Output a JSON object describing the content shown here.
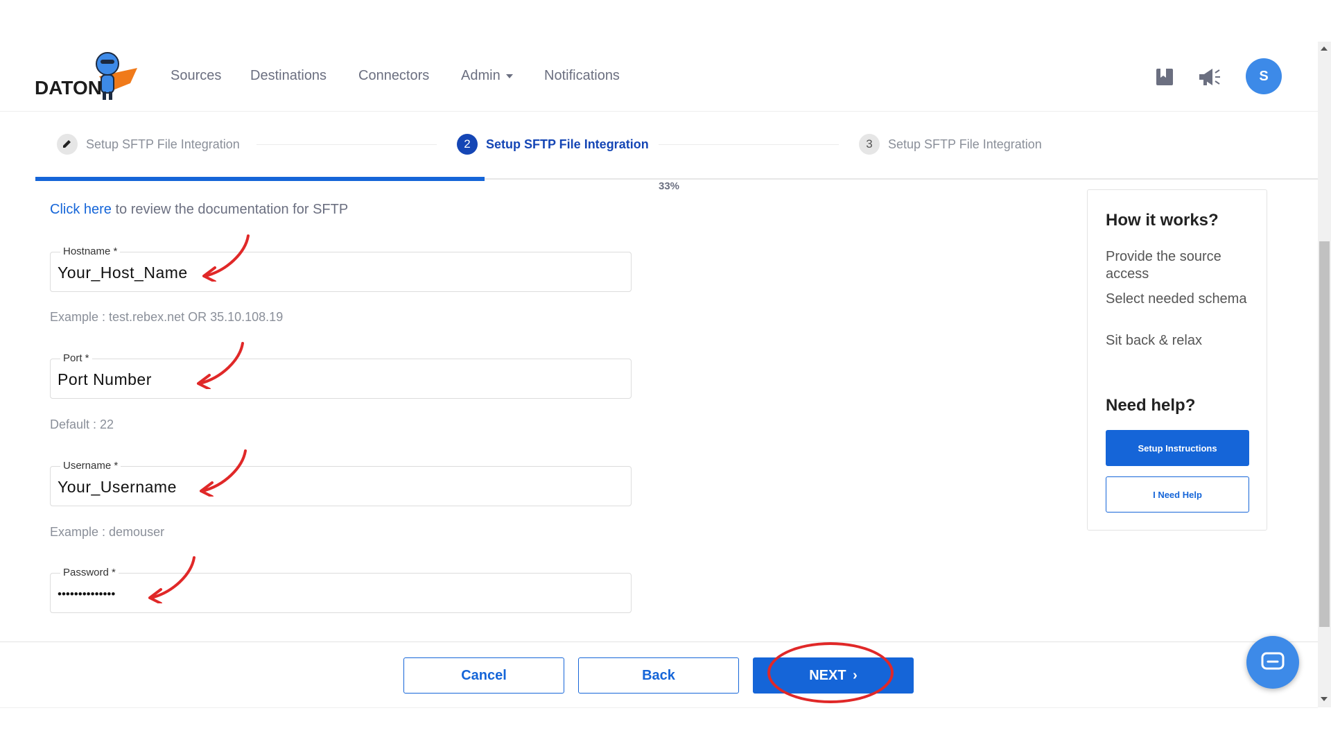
{
  "brand": {
    "logo_text": "DATON"
  },
  "nav": {
    "items": [
      {
        "label": "Sources"
      },
      {
        "label": "Destinations"
      },
      {
        "label": "Connectors"
      },
      {
        "label": "Admin"
      },
      {
        "label": "Notifications"
      }
    ],
    "avatar_initial": "S"
  },
  "stepper": {
    "steps": [
      {
        "number": "",
        "label": "Setup SFTP File Integration",
        "state": "completed"
      },
      {
        "number": "2",
        "label": "Setup SFTP File Integration",
        "state": "active"
      },
      {
        "number": "3",
        "label": "Setup SFTP File Integration",
        "state": "pending"
      }
    ],
    "progress_fraction": 0.33,
    "progress_label": "33%"
  },
  "form": {
    "doc_link_label": "Click here",
    "doc_text": " to review the documentation for SFTP",
    "fields": [
      {
        "label": "Hostname *",
        "value": "Your_Host_Name",
        "helper": "Example : test.rebex.net OR 35.10.108.19"
      },
      {
        "label": "Port *",
        "value": "Port Number",
        "helper": "Default : 22"
      },
      {
        "label": "Username *",
        "value": "Your_Username",
        "helper": "Example : demouser"
      },
      {
        "label": "Password *",
        "value": "••••••••••••••",
        "helper": ""
      }
    ]
  },
  "side_panel": {
    "title": "How it works?",
    "items": [
      "Provide the source access",
      "Select needed schema",
      "Sit back & relax"
    ],
    "help_title": "Need help?",
    "setup_button": "Setup Instructions",
    "help_button": "I Need Help"
  },
  "footer": {
    "cancel": "Cancel",
    "back": "Back",
    "next": "NEXT"
  },
  "colors": {
    "primary": "#1565d8",
    "annotation": "#e02828",
    "avatar": "#3d8ae8"
  }
}
